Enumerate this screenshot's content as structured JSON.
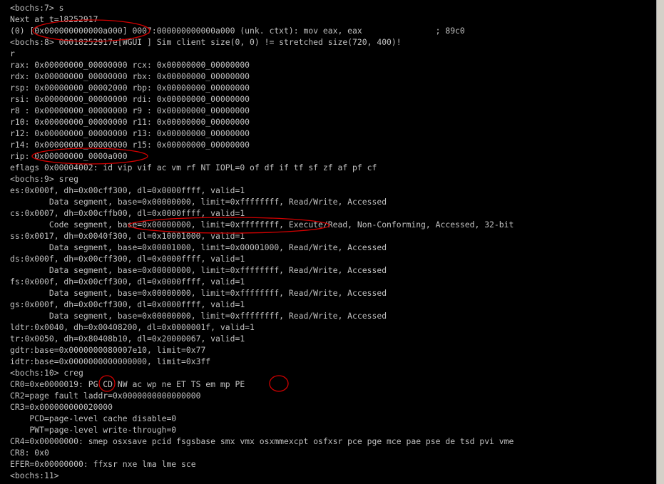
{
  "console": {
    "lines": [
      "<bochs:7> s",
      "Next at t=18252917",
      "(0) [0x000000000000a000] 0007:000000000000a000 (unk. ctxt): mov eax, eax               ; 89c0",
      "<bochs:8> 00018252917e[WGUI ] Sim client size(0, 0) != stretched size(720, 400)!",
      "r",
      "rax: 0x00000000_00000000 rcx: 0x00000000_00000000",
      "rdx: 0x00000000_00000000 rbx: 0x00000000_00000000",
      "rsp: 0x00000000_00002000 rbp: 0x00000000_00000000",
      "rsi: 0x00000000_00000000 rdi: 0x00000000_00000000",
      "r8 : 0x00000000_00000000 r9 : 0x00000000_00000000",
      "r10: 0x00000000_00000000 r11: 0x00000000_00000000",
      "r12: 0x00000000_00000000 r13: 0x00000000_00000000",
      "r14: 0x00000000_00000000 r15: 0x00000000_00000000",
      "rip: 0x00000000_0000a000",
      "eflags 0x00004002: id vip vif ac vm rf NT IOPL=0 of df if tf sf zf af pf cf",
      "<bochs:9> sreg",
      "es:0x000f, dh=0x00cff300, dl=0x0000ffff, valid=1",
      "        Data segment, base=0x00000000, limit=0xffffffff, Read/Write, Accessed",
      "cs:0x0007, dh=0x00cffb00, dl=0x0000ffff, valid=1",
      "        Code segment, base=0x00000000, limit=0xffffffff, Execute/Read, Non-Conforming, Accessed, 32-bit",
      "ss:0x0017, dh=0x0040f300, dl=0x10001000, valid=1",
      "        Data segment, base=0x00001000, limit=0x00001000, Read/Write, Accessed",
      "ds:0x000f, dh=0x00cff300, dl=0x0000ffff, valid=1",
      "        Data segment, base=0x00000000, limit=0xffffffff, Read/Write, Accessed",
      "fs:0x000f, dh=0x00cff300, dl=0x0000ffff, valid=1",
      "        Data segment, base=0x00000000, limit=0xffffffff, Read/Write, Accessed",
      "gs:0x000f, dh=0x00cff300, dl=0x0000ffff, valid=1",
      "        Data segment, base=0x00000000, limit=0xffffffff, Read/Write, Accessed",
      "ldtr:0x0040, dh=0x00408200, dl=0x0000001f, valid=1",
      "tr:0x0050, dh=0x80408b10, dl=0x20000067, valid=1",
      "gdtr:base=0x0000000080007e10, limit=0x77",
      "idtr:base=0x0000000000000000, limit=0x3ff",
      "<bochs:10> creg",
      "CR0=0xe0000019: PG CD NW ac wp ne ET TS em mp PE",
      "CR2=page fault laddr=0x0000000000000000",
      "CR3=0x000000000020000",
      "    PCD=page-level cache disable=0",
      "    PWT=page-level write-through=0",
      "CR4=0x00000000: smep osxsave pcid fsgsbase smx vmx osxmmexcpt osfxsr pce pge mce pae pse de tsd pvi vme",
      "CR8: 0x0",
      "EFER=0x00000000: ffxsr nxe lma lme sce",
      "<bochs:11> "
    ]
  },
  "colors": {
    "background": "#000000",
    "text": "#c0c0c0",
    "annotation": "#d40000"
  }
}
